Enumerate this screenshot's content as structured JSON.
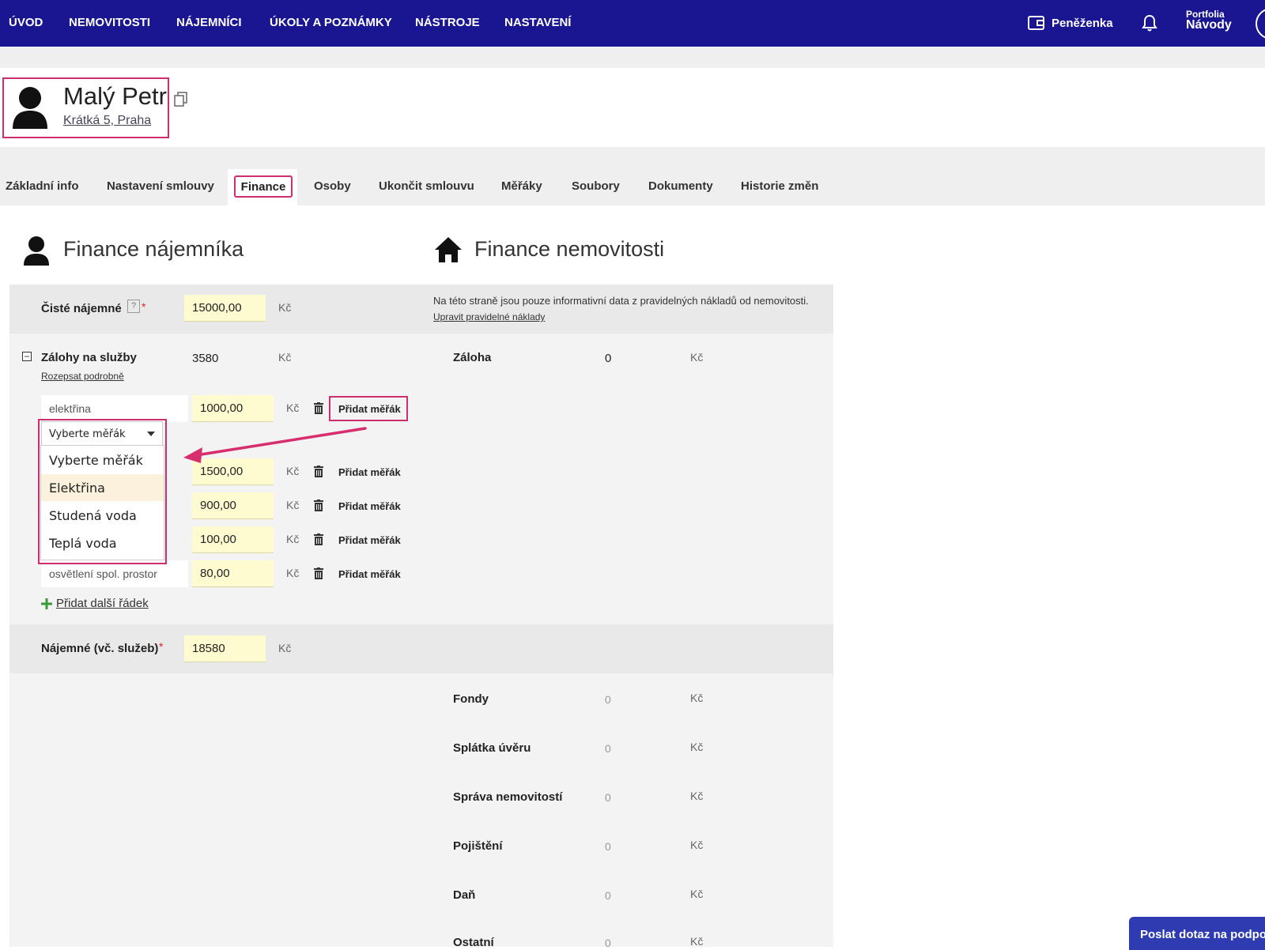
{
  "nav": {
    "items": [
      "ÚVOD",
      "NEMOVITOSTI",
      "NÁJEMNÍCI",
      "ÚKOLY A POZNÁMKY",
      "NÁSTROJE",
      "NASTAVENÍ"
    ],
    "wallet_label": "Peněženka",
    "portfolia_label": "Portfolia",
    "portfolia_name": "Návody"
  },
  "profile": {
    "name": "Malý Petr",
    "address": "Krátká 5, Praha"
  },
  "tabs": [
    "Základní info",
    "Nastavení smlouvy",
    "Finance",
    "Osoby",
    "Ukončit smlouvu",
    "Měřáky",
    "Soubory",
    "Dokumenty",
    "Historie změn"
  ],
  "active_tab": "Finance",
  "tenant": {
    "title": "Finance nájemníka",
    "ciste_label": "Čisté nájemné",
    "help_mark": "?",
    "required_mark": "*",
    "ciste_value": "15000,00",
    "currency": "Kč",
    "zalohy_label": "Zálohy na služby",
    "zalohy_total": "3580",
    "collapse_mark": "−",
    "rozepsat_link": "Rozepsat podrobně",
    "rows": [
      {
        "name": "elektřina",
        "amount": "1000,00",
        "action": "Přidat měřák"
      },
      {
        "name": "",
        "amount": "1500,00",
        "action": "Přidat měřák"
      },
      {
        "name": "",
        "amount": "900,00",
        "action": "Přidat měřák"
      },
      {
        "name": "",
        "amount": "100,00",
        "action": "Přidat měřák"
      },
      {
        "name": "osvětlení spol. prostor",
        "amount": "80,00",
        "action": "Přidat měřák"
      }
    ],
    "select_placeholder": "Vyberte měřák",
    "dropdown_options": [
      "Vyberte měřák",
      "Elektřina",
      "Studená voda",
      "Teplá voda"
    ],
    "dropdown_highlighted": "Elektřina",
    "add_row_link": "Přidat další řádek",
    "najemne_label": "Nájemné (vč. služeb)",
    "najemne_value": "18580"
  },
  "property": {
    "title": "Finance nemovitosti",
    "info_text": "Na této straně jsou pouze informativní data z pravidelných nákladů od nemovitosti.",
    "edit_link": "Upravit pravidelné náklady",
    "zaloha_label": "Záloha",
    "zaloha_value": "0",
    "items": [
      {
        "label": "Fondy",
        "value": "0"
      },
      {
        "label": "Splátka úvěru",
        "value": "0"
      },
      {
        "label": "Správa nemovitostí",
        "value": "0"
      },
      {
        "label": "Pojištění",
        "value": "0"
      },
      {
        "label": "Daň",
        "value": "0"
      },
      {
        "label": "Ostatní",
        "value": "0"
      }
    ]
  },
  "support_button": "Poslat dotaz na podporu",
  "colors": {
    "nav_bg": "#1a1691",
    "highlight": "#cc2e6e",
    "field_yellow": "#fffbd0",
    "add_green": "#3a9a3a"
  }
}
